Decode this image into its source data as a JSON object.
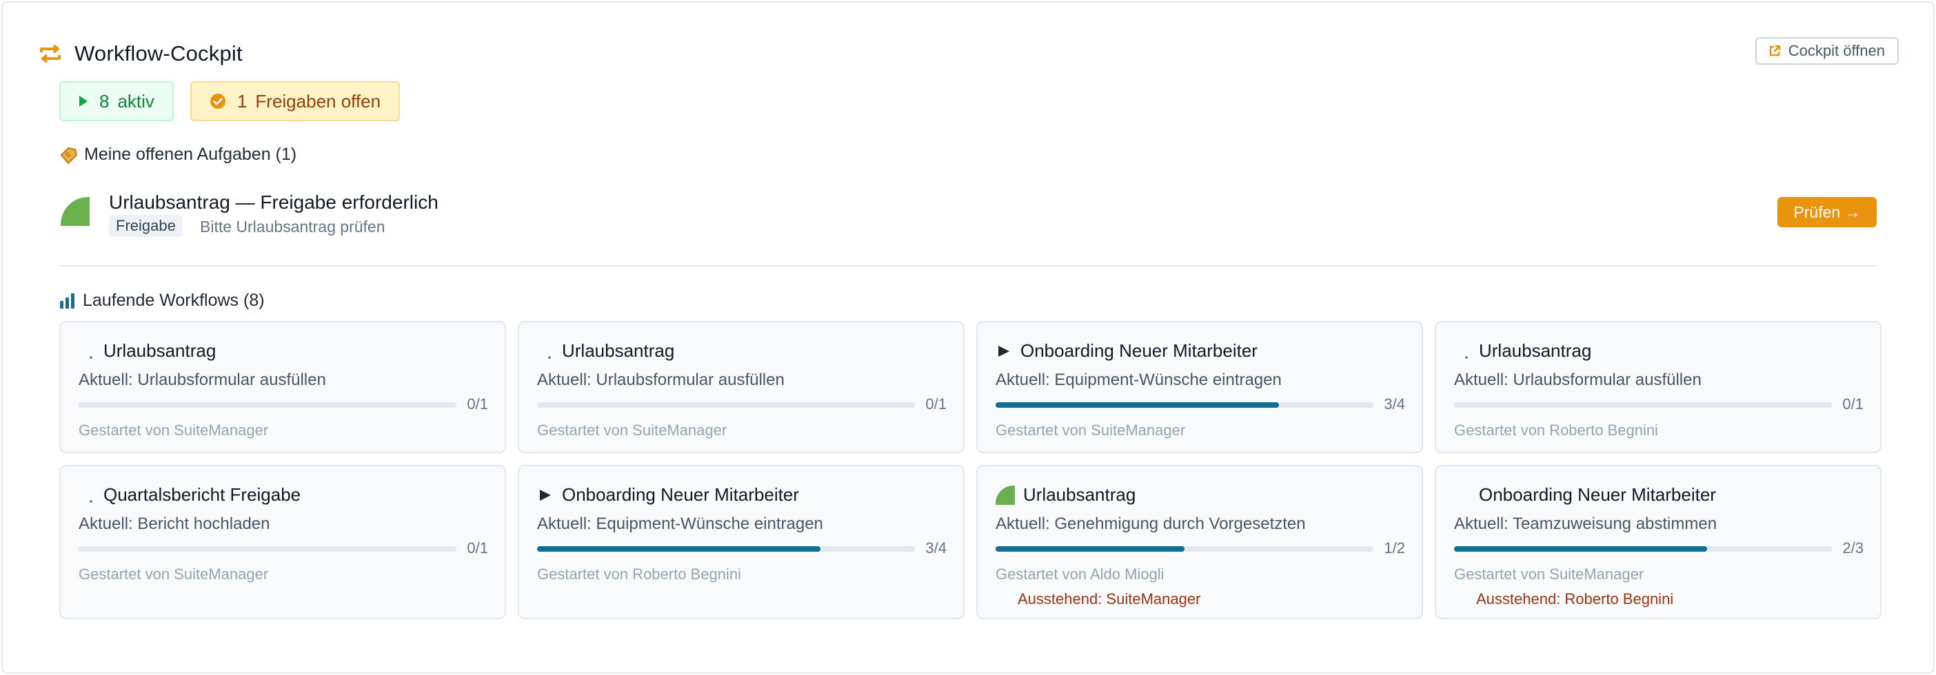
{
  "header": {
    "title": "Workflow-Cockpit",
    "open_button": "Cockpit öffnen"
  },
  "stats": {
    "active_count": "8",
    "active_label": "aktiv",
    "pending_count": "1",
    "pending_label": "Freigaben offen"
  },
  "tasks_section": {
    "title": "Meine offenen Aufgaben (1)",
    "items": [
      {
        "title": "Urlaubsantrag — Freigabe erforderlich",
        "badge": "Freigabe",
        "description": "Bitte Urlaubsantrag prüfen",
        "action": "Prüfen →"
      }
    ]
  },
  "workflows_section": {
    "title": "Laufende Workflows (8)",
    "items": [
      {
        "icon": "dot-icon",
        "name": "Urlaubsantrag",
        "current": "Aktuell: Urlaubsformular ausfüllen",
        "progress_label": "0/1",
        "progress": 0,
        "starter": "Gestartet von SuiteManager",
        "pending": ""
      },
      {
        "icon": "dot-icon",
        "name": "Urlaubsantrag",
        "current": "Aktuell: Urlaubsformular ausfüllen",
        "progress_label": "0/1",
        "progress": 0,
        "starter": "Gestartet von SuiteManager",
        "pending": ""
      },
      {
        "icon": "play-icon",
        "name": "Onboarding Neuer Mitarbeiter",
        "current": "Aktuell: Equipment-Wünsche eintragen",
        "progress_label": "3/4",
        "progress": 0.75,
        "starter": "Gestartet von SuiteManager",
        "pending": ""
      },
      {
        "icon": "dot-icon",
        "name": "Urlaubsantrag",
        "current": "Aktuell: Urlaubsformular ausfüllen",
        "progress_label": "0/1",
        "progress": 0,
        "starter": "Gestartet von Roberto Begnini",
        "pending": ""
      },
      {
        "icon": "dot-icon",
        "name": "Quartalsbericht Freigabe",
        "current": "Aktuell: Bericht hochladen",
        "progress_label": "0/1",
        "progress": 0,
        "starter": "Gestartet von SuiteManager",
        "pending": ""
      },
      {
        "icon": "play-icon",
        "name": "Onboarding Neuer Mitarbeiter",
        "current": "Aktuell: Equipment-Wünsche eintragen",
        "progress_label": "3/4",
        "progress": 0.75,
        "starter": "Gestartet von Roberto Begnini",
        "pending": ""
      },
      {
        "icon": "quarter-circle-icon",
        "name": "Urlaubsantrag",
        "current": "Aktuell: Genehmigung durch Vorgesetzten",
        "progress_label": "1/2",
        "progress": 0.5,
        "starter": "Gestartet von Aldo Miogli",
        "pending": "Ausstehend: SuiteManager"
      },
      {
        "icon": "blank-icon",
        "name": "Onboarding Neuer Mitarbeiter",
        "current": "Aktuell: Teamzuweisung abstimmen",
        "progress_label": "2/3",
        "progress": 0.67,
        "starter": "Gestartet von SuiteManager",
        "pending": "Ausstehend: Roberto Begnini"
      }
    ]
  },
  "colors": {
    "accent": "#e8940f",
    "progress": "#0f6f94",
    "quarter_green": "#6ab04c",
    "active_green": "#15803d",
    "pending_brown": "#92400e"
  }
}
